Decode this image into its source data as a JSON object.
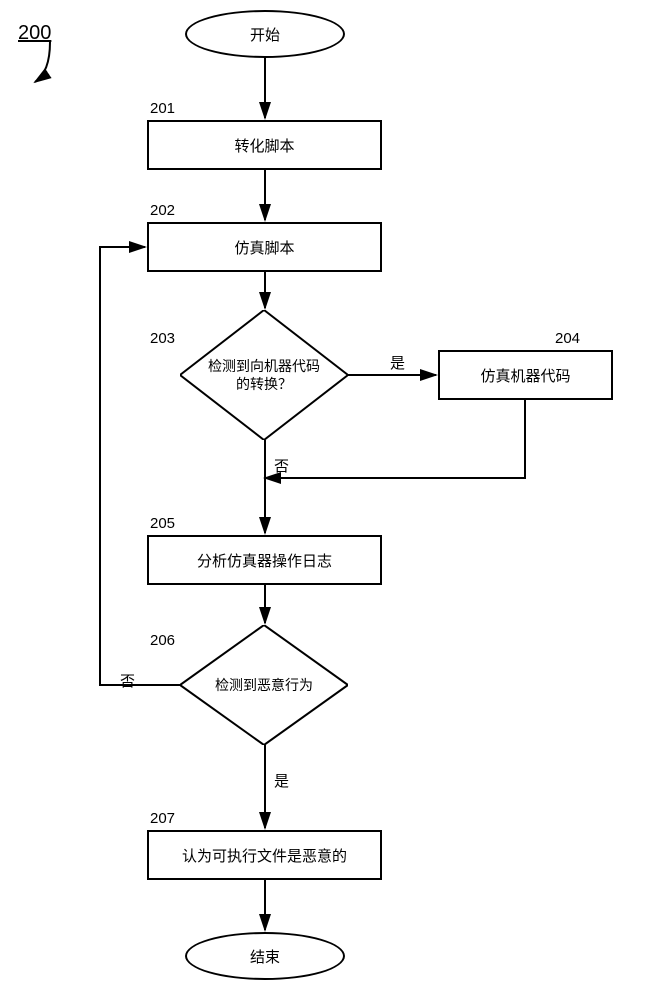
{
  "figure_ref": "200",
  "start": "开始",
  "end": "结束",
  "steps": {
    "201": {
      "num": "201",
      "text": "转化脚本"
    },
    "202": {
      "num": "202",
      "text": "仿真脚本"
    },
    "203": {
      "num": "203",
      "text": "检测到向机器代码的转换？"
    },
    "204": {
      "num": "204",
      "text": "仿真机器代码"
    },
    "205": {
      "num": "205",
      "text": "分析仿真器操作日志"
    },
    "206": {
      "num": "206",
      "text": "检测到恶意行为"
    },
    "207": {
      "num": "207",
      "text": "认为可执行文件是恶意的"
    }
  },
  "branch": {
    "yes": "是",
    "no": "否"
  },
  "chart_data": {
    "type": "flowchart",
    "title": "",
    "nodes": [
      {
        "id": "start",
        "kind": "terminator",
        "label": "开始"
      },
      {
        "id": "201",
        "kind": "process",
        "label": "转化脚本"
      },
      {
        "id": "202",
        "kind": "process",
        "label": "仿真脚本"
      },
      {
        "id": "203",
        "kind": "decision",
        "label": "检测到向机器代码的转换？"
      },
      {
        "id": "204",
        "kind": "process",
        "label": "仿真机器代码"
      },
      {
        "id": "205",
        "kind": "process",
        "label": "分析仿真器操作日志"
      },
      {
        "id": "206",
        "kind": "decision",
        "label": "检测到恶意行为"
      },
      {
        "id": "207",
        "kind": "process",
        "label": "认为可执行文件是恶意的"
      },
      {
        "id": "end",
        "kind": "terminator",
        "label": "结束"
      }
    ],
    "edges": [
      {
        "from": "start",
        "to": "201"
      },
      {
        "from": "201",
        "to": "202"
      },
      {
        "from": "202",
        "to": "203"
      },
      {
        "from": "203",
        "to": "204",
        "label": "是"
      },
      {
        "from": "203",
        "to": "205",
        "label": "否"
      },
      {
        "from": "204",
        "to": "205_merge"
      },
      {
        "from": "205",
        "to": "206"
      },
      {
        "from": "206",
        "to": "207",
        "label": "是"
      },
      {
        "from": "206",
        "to": "202",
        "label": "否"
      },
      {
        "from": "207",
        "to": "end"
      }
    ]
  }
}
